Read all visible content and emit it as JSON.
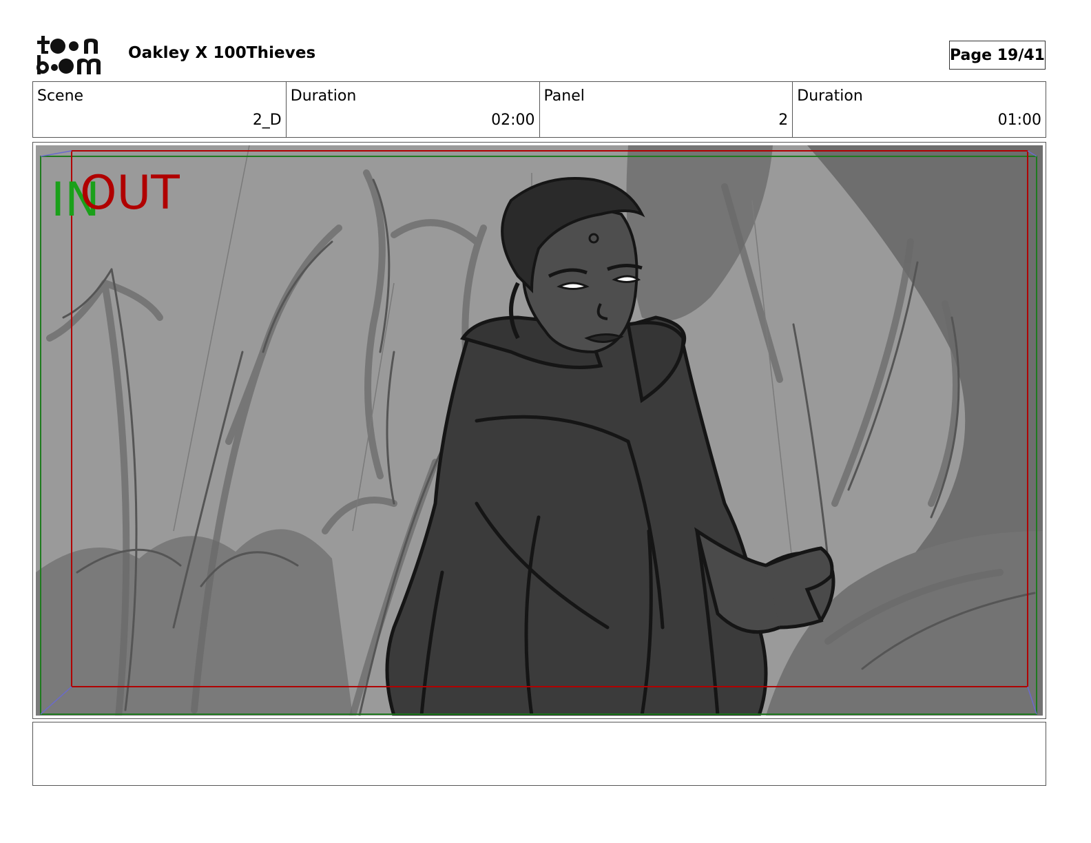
{
  "header": {
    "logo_text": "toon boom",
    "title": "Oakley X 100Thieves",
    "page_label": "Page 19/41"
  },
  "info": [
    {
      "label": "Scene",
      "value": "2_D"
    },
    {
      "label": "Duration",
      "value": "02:00"
    },
    {
      "label": "Panel",
      "value": "2"
    },
    {
      "label": "Duration",
      "value": "01:00"
    }
  ],
  "panel": {
    "in_marker": "IN",
    "out_marker": "OUT",
    "in_color": "#1aa01a",
    "out_color": "#b00000"
  },
  "notes": {
    "text": ""
  }
}
